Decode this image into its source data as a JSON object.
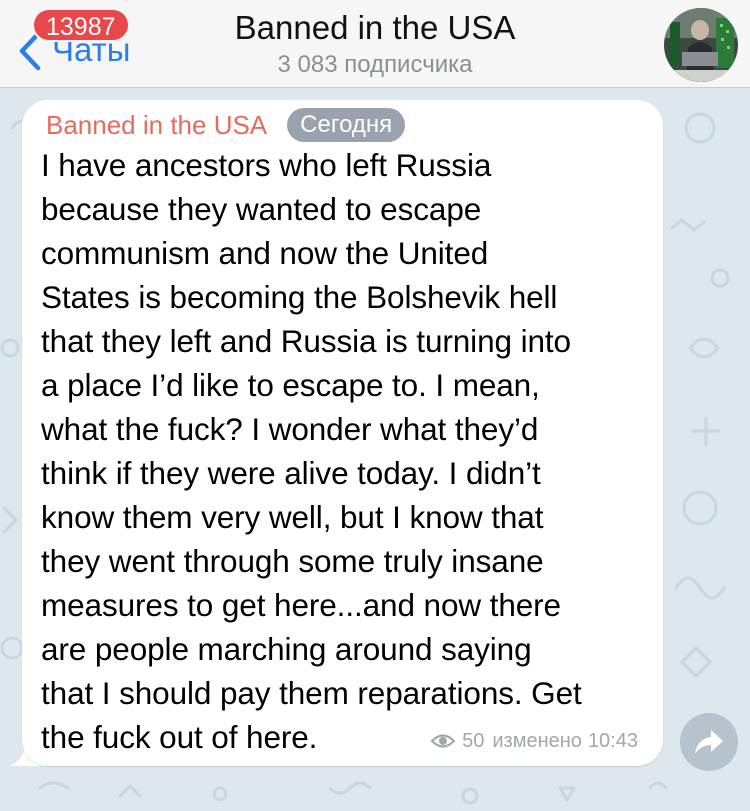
{
  "header": {
    "back_label": "Чаты",
    "unread_count": "13987",
    "title": "Banned in the USA",
    "subscribers": "3 083 подписчика"
  },
  "message": {
    "sender": "Banned in the USA",
    "date_label": "Сегодня",
    "text": "I have ancestors who left Russia\nbecause they wanted to escape\ncommunism and now the United\nStates is becoming the Bolshevik hell\nthat they left and Russia is turning into\na place I’d like to escape to. I mean,\nwhat the fuck? I wonder what they’d\nthink if they were alive today. I didn’t\nknow them very well, but I know that\nthey went through some truly insane\nmeasures to get here...and now there\nare people marching around saying\nthat I should pay them reparations. Get\nthe fuck out of here.",
    "views": "50",
    "edited_label": "изменено",
    "time": "10:43"
  },
  "icons": {
    "back": "chevron-left-icon",
    "views": "eye-icon",
    "share": "share-arrow-icon"
  },
  "colors": {
    "accent": "#2b7de9",
    "badge": "#e8474b",
    "sender": "#e66b5b",
    "wallpaper": "#dde7ee"
  }
}
